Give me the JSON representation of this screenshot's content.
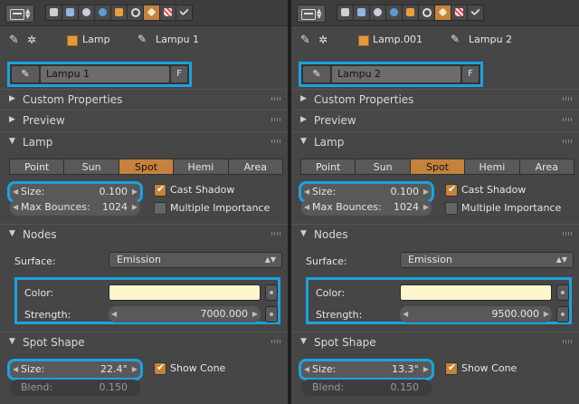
{
  "panels": [
    {
      "breadcrumb": {
        "object": "Lamp",
        "lamp": "Lampu 1"
      },
      "datablock": {
        "name": "Lampu 1",
        "fake_user": "F"
      },
      "sections": {
        "custom_properties": "Custom Properties",
        "preview": "Preview",
        "lamp": "Lamp",
        "nodes": "Nodes",
        "spot_shape": "Spot Shape"
      },
      "lamp_types": [
        "Point",
        "Sun",
        "Spot",
        "Hemi",
        "Area"
      ],
      "active_type": "Spot",
      "size": {
        "label": "Size:",
        "value": "0.100"
      },
      "max_bounces": {
        "label": "Max Bounces:",
        "value": "1024"
      },
      "cast_shadow": {
        "label": "Cast Shadow",
        "checked": true
      },
      "multiple_importance": {
        "label": "Multiple Importance",
        "checked": false
      },
      "surface": {
        "label": "Surface:",
        "value": "Emission"
      },
      "color": {
        "label": "Color:",
        "value": "#fff5cc"
      },
      "strength": {
        "label": "Strength:",
        "value": "7000.000"
      },
      "spot_size": {
        "label": "Size:",
        "value": "22.4°"
      },
      "show_cone": {
        "label": "Show Cone",
        "checked": true
      },
      "blend": {
        "label": "Blend:",
        "value": "0.150"
      }
    },
    {
      "breadcrumb": {
        "object": "Lamp.001",
        "lamp": "Lampu 2"
      },
      "datablock": {
        "name": "Lampu 2",
        "fake_user": "F"
      },
      "sections": {
        "custom_properties": "Custom Properties",
        "preview": "Preview",
        "lamp": "Lamp",
        "nodes": "Nodes",
        "spot_shape": "Spot Shape"
      },
      "lamp_types": [
        "Point",
        "Sun",
        "Spot",
        "Hemi",
        "Area"
      ],
      "active_type": "Spot",
      "size": {
        "label": "Size:",
        "value": "0.100"
      },
      "max_bounces": {
        "label": "Max Bounces:",
        "value": "1024"
      },
      "cast_shadow": {
        "label": "Cast Shadow",
        "checked": true
      },
      "multiple_importance": {
        "label": "Multiple Importance",
        "checked": false
      },
      "surface": {
        "label": "Surface:",
        "value": "Emission"
      },
      "color": {
        "label": "Color:",
        "value": "#fff5cc"
      },
      "strength": {
        "label": "Strength:",
        "value": "9500.000"
      },
      "spot_size": {
        "label": "Size:",
        "value": "13.3°"
      },
      "show_cone": {
        "label": "Show Cone",
        "checked": true
      },
      "blend": {
        "label": "Blend:",
        "value": "0.150"
      }
    }
  ],
  "icons": {
    "editor_type": "properties-editor-icon",
    "context_tabs": [
      "render-icon",
      "render-layers-icon",
      "scene-icon",
      "world-icon",
      "object-icon",
      "constraints-icon",
      "lamp-data-icon",
      "texture-icon",
      "particles-icon"
    ],
    "active_tab": "lamp-data-icon"
  },
  "colors": {
    "highlight": "#1aa3e0",
    "accent": "#c5823c",
    "lamp_color": "#fff5cc"
  }
}
